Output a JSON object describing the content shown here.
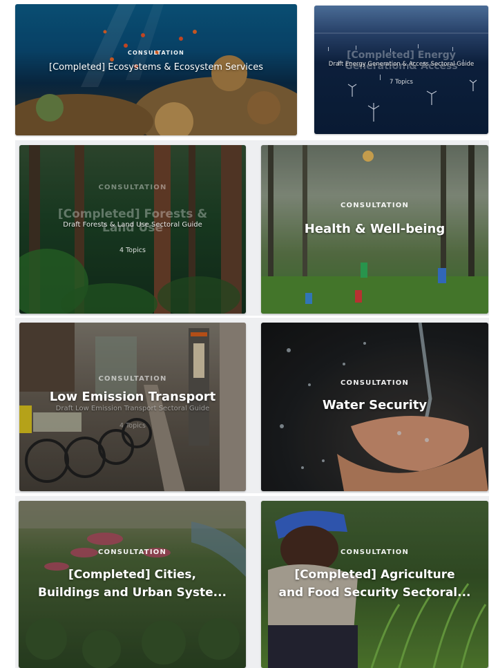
{
  "cards": [
    {
      "id": "ecosystems",
      "kicker": "CONSULTATION",
      "title": "[Completed] Ecosystems & Ecosystem Services"
    },
    {
      "id": "energy",
      "ghost_title": "[Completed] Energy Generation & Access",
      "subtitle": "Draft Energy Generation & Access Sectoral Guide",
      "topics": "7 Topics"
    },
    {
      "id": "forests",
      "kicker": "CONSULTATION",
      "ghost_title": "[Completed] Forests & Land Use",
      "subtitle": "Draft Forests & Land Use Sectoral Guide",
      "topics": "4 Topics"
    },
    {
      "id": "health",
      "kicker": "CONSULTATION",
      "title": "Health & Well-being"
    },
    {
      "id": "transport",
      "kicker": "CONSULTATION",
      "title": "Low Emission Transport",
      "subtitle": "Draft Low Emission Transport Sectoral Guide",
      "topics": "4 Topics"
    },
    {
      "id": "water",
      "kicker": "CONSULTATION",
      "title": "Water Security"
    },
    {
      "id": "cities",
      "kicker": "CONSULTATION",
      "title_line1": "[Completed] Cities,",
      "title_line2": "Buildings and Urban Syste..."
    },
    {
      "id": "agriculture",
      "kicker": "CONSULTATION",
      "title_line1": "[Completed] Agriculture",
      "title_line2": "and Food Security Sectoral..."
    }
  ],
  "colors": {
    "ocean_top": "#0b5f8c",
    "ocean_deep": "#0a2e4c",
    "coral": "#a77a44",
    "sea_night": "#0c1f3b",
    "forest": "#1f4a2a",
    "meadow": "#3f7a33",
    "street": "#6b6257",
    "water_dark": "#1b1d1f",
    "skin": "#c98d6e",
    "garden": "#2f4a26",
    "field": "#5b8b34"
  }
}
